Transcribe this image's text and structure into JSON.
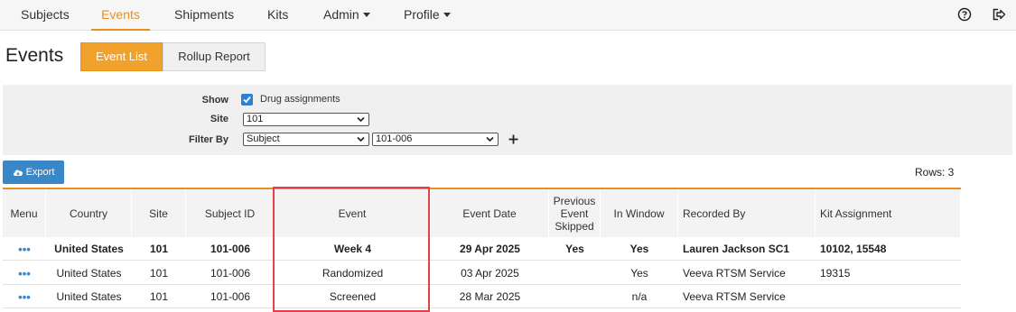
{
  "nav": {
    "items": [
      "Subjects",
      "Events",
      "Shipments",
      "Kits",
      "Admin",
      "Profile"
    ],
    "icons": [
      "help-circle-icon",
      "logout-icon"
    ]
  },
  "header": {
    "title": "Events",
    "tabs": [
      "Event List",
      "Rollup Report"
    ]
  },
  "filters": {
    "show_label": "Show",
    "show_option": "Drug assignments",
    "show_checked": true,
    "site_label": "Site",
    "site_value": "101",
    "filterby_label": "Filter By",
    "filterby_field": "Subject",
    "filterby_value": "101-006",
    "add_icon": "plus-icon"
  },
  "toolbar": {
    "export_label": "Export",
    "export_icon": "cloud-download-icon",
    "rows_label": "Rows: 3"
  },
  "table": {
    "headers": [
      "Menu",
      "Country",
      "Site",
      "Subject ID",
      "Event",
      "Event Date",
      "Previous Event Skipped",
      "In Window",
      "Recorded By",
      "Kit Assignment"
    ],
    "rows": [
      {
        "menu": "•••",
        "country": "United States",
        "site": "101",
        "subject": "101-006",
        "event": "Week 4",
        "date": "29 Apr 2025",
        "skipped": "Yes",
        "window": "Yes",
        "recorded": "Lauren Jackson SC1",
        "kit": "10102, 15548"
      },
      {
        "menu": "•••",
        "country": "United States",
        "site": "101",
        "subject": "101-006",
        "event": "Randomized",
        "date": "03 Apr 2025",
        "skipped": "",
        "window": "Yes",
        "recorded": "Veeva RTSM Service",
        "kit": "19315"
      },
      {
        "menu": "•••",
        "country": "United States",
        "site": "101",
        "subject": "101-006",
        "event": "Screened",
        "date": "28 Mar 2025",
        "skipped": "",
        "window": "n/a",
        "recorded": "Veeva RTSM Service",
        "kit": ""
      }
    ]
  },
  "colors": {
    "accent": "#e8901a",
    "primary": "#3a87c8",
    "highlight": "#e0414a"
  }
}
